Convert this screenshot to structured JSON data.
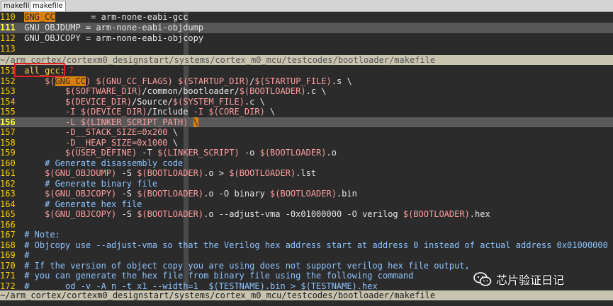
{
  "tabs": [
    {
      "label": "makefile",
      "active": false
    },
    {
      "label": "makefile",
      "active": true
    }
  ],
  "top_pane": {
    "lines": [
      {
        "num": "110",
        "text": "GNG_CC       = arm-none-eabi-gcc"
      },
      {
        "num": "111",
        "text": "GNU_OBJDUMP = arm-none-eabi-objdump"
      },
      {
        "num": "112",
        "text": "GNU_OBJCOPY = arm-none-eabi-objcopy"
      },
      {
        "num": "113",
        "text": ""
      }
    ],
    "status": "~/arm_cortex/cortexm0_designstart/systems/cortex_m0_mcu/testcodes/bootloader/makefile"
  },
  "bottom_pane": {
    "lines": [
      {
        "num": "151",
        "text": "all_gcc:"
      },
      {
        "num": "152",
        "text": "    $(GNG_CC) $(GNU_CC_FLAGS) $(STARTUP_DIR)/$(STARTUP_FILE).s \\"
      },
      {
        "num": "153",
        "text": "        $(SOFTWARE_DIR)/common/bootloader/$(BOOTLOADER).c \\"
      },
      {
        "num": "154",
        "text": "        $(DEVICE_DIR)/Source/$(SYSTEM_FILE).c \\"
      },
      {
        "num": "155",
        "text": "        -I $(DEVICE_DIR)/Include -I $(CORE_DIR) \\"
      },
      {
        "num": "156",
        "text": "        -L $(LINKER_SCRIPT_PATH) \\"
      },
      {
        "num": "157",
        "text": "        -D__STACK_SIZE=0x200 \\"
      },
      {
        "num": "158",
        "text": "        -D__HEAP_SIZE=0x1000 \\"
      },
      {
        "num": "159",
        "text": "        $(USER_DEFINE) -T $(LINKER_SCRIPT) -o $(BOOTLOADER).o"
      },
      {
        "num": "160",
        "text": "    # Generate disassembly code"
      },
      {
        "num": "161",
        "text": "    $(GNU_OBJDUMP) -S $(BOOTLOADER).o > $(BOOTLOADER).lst"
      },
      {
        "num": "162",
        "text": "    # Generate binary file"
      },
      {
        "num": "163",
        "text": "    $(GNU_OBJCOPY) -S $(BOOTLOADER).o -O binary $(BOOTLOADER).bin"
      },
      {
        "num": "164",
        "text": "    # Generate hex file"
      },
      {
        "num": "165",
        "text": "    $(GNU_OBJCOPY) -S $(BOOTLOADER).o --adjust-vma -0x01000000 -O verilog $(BOOTLOADER).hex"
      },
      {
        "num": "166",
        "text": ""
      },
      {
        "num": "167",
        "text": "# Note:"
      },
      {
        "num": "168",
        "text": "# Objcopy use --adjust-vma so that the Verilog hex address start at address 0 instead of actual address 0x01000000"
      },
      {
        "num": "169",
        "text": "#"
      },
      {
        "num": "170",
        "text": "# If the version of object copy you are using does not support verilog hex file output,"
      },
      {
        "num": "171",
        "text": "# you can generate the hex file from binary file using the following command"
      },
      {
        "num": "172",
        "text": "#       od -v -A n -t x1 --width=1  $(TESTNAME).bin > $(TESTNAME).hex"
      }
    ],
    "status": "~/arm_cortex/cortexm0_designstart/systems/cortex_m0_mcu/testcodes/bootloader/makefile"
  },
  "annotation": {
    "number": "7"
  },
  "watermark": {
    "text": "芯片验证日记",
    "icon": "wechat-icon"
  },
  "colors": {
    "background": "#2b2b2b",
    "line_numbers": "#ffd000",
    "variables": "#ff9f9f",
    "comments": "#8ec3ff",
    "highlight_box": "#e02020",
    "search_match": "#d98010",
    "status_bar": "#c8c4b0"
  }
}
